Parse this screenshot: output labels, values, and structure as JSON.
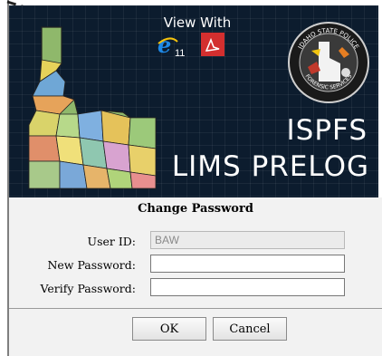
{
  "banner": {
    "view_with": "View With",
    "ie_version": "11",
    "title_line1": "ISPFS",
    "title_line2": "LIMS PRELOG",
    "seal_top_text": "IDAHO STATE POLICE",
    "seal_bottom_text": "FORENSIC SERVICES"
  },
  "form": {
    "heading": "Change Password",
    "user_id_label": "User ID:",
    "user_id_value": "BAW",
    "new_password_label": "New Password:",
    "new_password_value": "",
    "verify_password_label": "Verify Password:",
    "verify_password_value": ""
  },
  "buttons": {
    "ok": "OK",
    "cancel": "Cancel"
  },
  "colors": {
    "banner_bg": "#0c1c2e",
    "panel_bg": "#f2f2f2",
    "ie_blue": "#1e88e5",
    "pdf_red": "#d32f2f"
  },
  "icons": [
    "internet-explorer-icon",
    "adobe-pdf-icon",
    "idaho-map-image",
    "isp-seal-logo"
  ]
}
